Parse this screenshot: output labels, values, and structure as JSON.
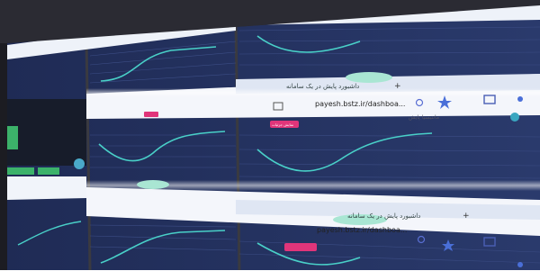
{
  "scene": {
    "description_colors": {
      "screen_bg": "#263561",
      "screen_bg_dark": "#1d2850",
      "browser_bar": "#f3f5fb",
      "tabstrip": "#dfe6f3",
      "line": "#49d0c8",
      "accent_red": "#e0357a",
      "accent_blue": "#5a6fd3",
      "bezel": "#3a3a40",
      "floor": "#7a4a2a",
      "light_glow": "#ffffff"
    }
  },
  "browser": {
    "tab_title": "داشبورد پایش در یک سامانه",
    "new_tab": "+",
    "url": "payesh.bstz.ir/dashboa...",
    "username": "مانتیسیا پایش",
    "page_button": "نمایش جزئیات"
  },
  "panels": [
    {
      "id": "top-left-screen",
      "curve": "rise"
    },
    {
      "id": "top-middle-screen",
      "curve": "rise"
    },
    {
      "id": "top-right-screen",
      "curve": "dip"
    },
    {
      "id": "middle-left-screen",
      "curve": "flat"
    },
    {
      "id": "middle-middle-screen",
      "curve": "rise"
    },
    {
      "id": "middle-right-screen",
      "curve": "dip"
    },
    {
      "id": "bottom-left-screen",
      "curve": "rise"
    },
    {
      "id": "bottom-middle-screen",
      "curve": "rise"
    },
    {
      "id": "bottom-right-screen",
      "curve": "dip"
    }
  ]
}
